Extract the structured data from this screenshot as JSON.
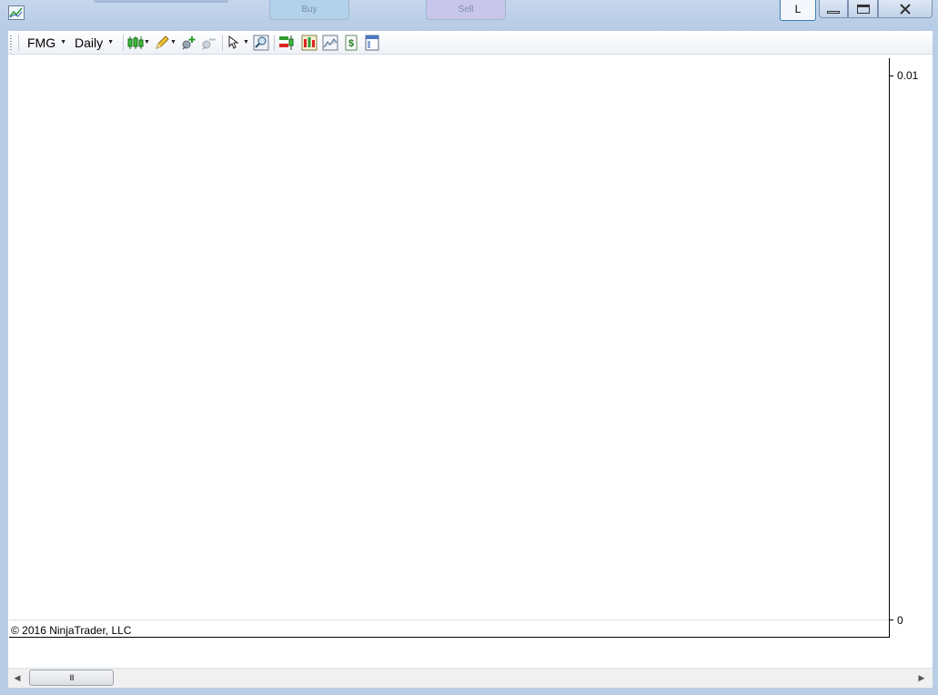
{
  "titlebar": {
    "buy_label": "Buy",
    "sell_label": "Sell",
    "layout_button": "L"
  },
  "toolbar": {
    "instrument": "FMG",
    "interval": "Daily"
  },
  "chart": {
    "price_axis_top": "0.01",
    "price_axis_bottom": "0",
    "copyright": "© 2016 NinjaTrader, LLC"
  },
  "chart_data": {
    "type": "line",
    "instrument": "FMG",
    "interval": "Daily",
    "series": [],
    "ylim": [
      0,
      0.01
    ],
    "y_ticks": [
      "0.01",
      "0"
    ],
    "grid": false
  },
  "scrollbar": {
    "thumb_grip": "III"
  },
  "colors": {
    "window_frame": "#b9cde6",
    "chart_background": "#ffffff",
    "axis_line": "#000000",
    "layout_button_border": "#3c7fb1"
  },
  "icons": [
    "chart-app-icon",
    "candlestick-style-icon",
    "pencil-draw-icon",
    "pin-add-icon",
    "pin-remove-icon",
    "pointer-icon",
    "zoom-icon",
    "order-entry-icon",
    "bar-chart-icon",
    "data-series-icon",
    "strategy-dollar-icon",
    "properties-icon"
  ]
}
